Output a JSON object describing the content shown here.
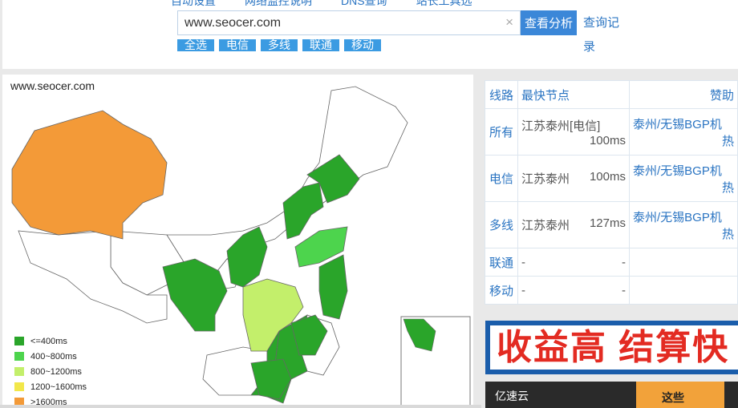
{
  "top_nav": [
    "自动设置",
    "网络监控说明",
    "DNS查询",
    "站长工具选"
  ],
  "search": {
    "value": "www.seocer.com",
    "clear_icon": "×"
  },
  "analyze_button": "查看分析",
  "records_link": "查询记录",
  "filters": [
    "全选",
    "电信",
    "多线",
    "联通",
    "移动"
  ],
  "map": {
    "title": "www.seocer.com",
    "legend": [
      {
        "label": "<=400ms",
        "color": "#2aa52a"
      },
      {
        "label": "400~800ms",
        "color": "#4dd44d"
      },
      {
        "label": "800~1200ms",
        "color": "#c3ef6b"
      },
      {
        "label": "1200~1600ms",
        "color": "#f2e74a"
      },
      {
        "label": ">1600ms",
        "color": "#f39a38"
      }
    ]
  },
  "table": {
    "headers": [
      "线路",
      "最快节点",
      "赞助"
    ],
    "rows": [
      {
        "line": "所有",
        "node": "江苏泰州[电信]",
        "time": "100ms",
        "sponsor": "泰州/无锡BGP机",
        "sponsor2": "热"
      },
      {
        "line": "电信",
        "node": "江苏泰州",
        "time": "100ms",
        "sponsor": "泰州/无锡BGP机",
        "sponsor2": "热"
      },
      {
        "line": "多线",
        "node": "江苏泰州",
        "time": "127ms",
        "sponsor": "泰州/无锡BGP机",
        "sponsor2": "热"
      },
      {
        "line": "联通",
        "node": "-",
        "time": "-",
        "sponsor": "",
        "sponsor2": ""
      },
      {
        "line": "移动",
        "node": "-",
        "time": "-",
        "sponsor": "",
        "sponsor2": ""
      }
    ]
  },
  "banner1": "收益高 结算快",
  "banner2": {
    "logo": "亿速云",
    "text": "这些"
  }
}
